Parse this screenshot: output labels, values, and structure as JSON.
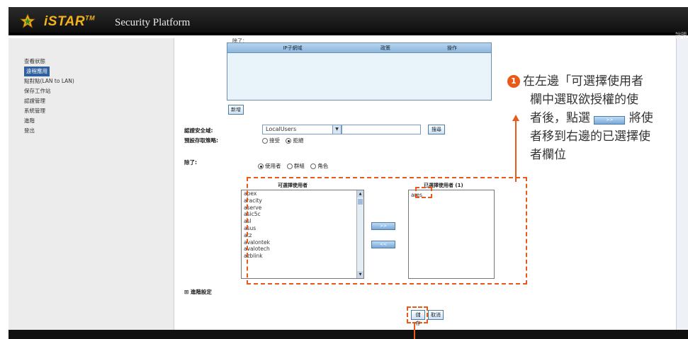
{
  "app": {
    "brand": "iSTAR",
    "tm": "TM",
    "subtitle": "Security Platform",
    "help_label": "說明"
  },
  "sidebar": {
    "items": [
      {
        "label": "查看狀態"
      },
      {
        "label": "遠程應用"
      },
      {
        "label": "點對點(LAN to LAN)"
      },
      {
        "label": "保存工作站"
      },
      {
        "label": "認證管理"
      },
      {
        "label": "系統管理"
      },
      {
        "label": "進階"
      },
      {
        "label": "登出"
      }
    ]
  },
  "ip_section": {
    "caption": "除了：",
    "columns": [
      "IP子網域",
      "政策",
      "操作"
    ],
    "new_button": "新增"
  },
  "auth": {
    "domain_label": "認證安全域:",
    "domain_value": "LocalUsers",
    "search_button": "搜尋",
    "default_policy_label": "預設存取策略:",
    "policy_options": [
      "接受",
      "拒絕"
    ],
    "except_label": "除了:",
    "except_options": [
      "使用者",
      "群組",
      "角色"
    ]
  },
  "users": {
    "available_title": "可選擇使用者",
    "selected_title": "已選擇使用者 (1)",
    "available": [
      "apex",
      "aracity",
      "aserve",
      "asic5c",
      "asl",
      "asus",
      "atz",
      "avalontek",
      "avalotech",
      "azblink"
    ],
    "selected": [
      "ares"
    ],
    "add_button": ">>",
    "remove_button": "<<"
  },
  "advanced": {
    "label": "進階設定",
    "toggle": "⊞"
  },
  "actions": {
    "save": "儲存",
    "cancel": "取消"
  },
  "callout": {
    "step": "1",
    "line1": "在左邊「可選擇使用者",
    "line2": "欄中選取欲授權的使",
    "line3a": "者後，點選",
    "line3b": "將使",
    "line4": "者移到右邊的已選擇使",
    "line5": "者欄位",
    "inline_button": ">>"
  },
  "colors": {
    "accent": "#e85a1a",
    "brand": "#f3b21c",
    "nav_active": "#2f5f9e"
  }
}
